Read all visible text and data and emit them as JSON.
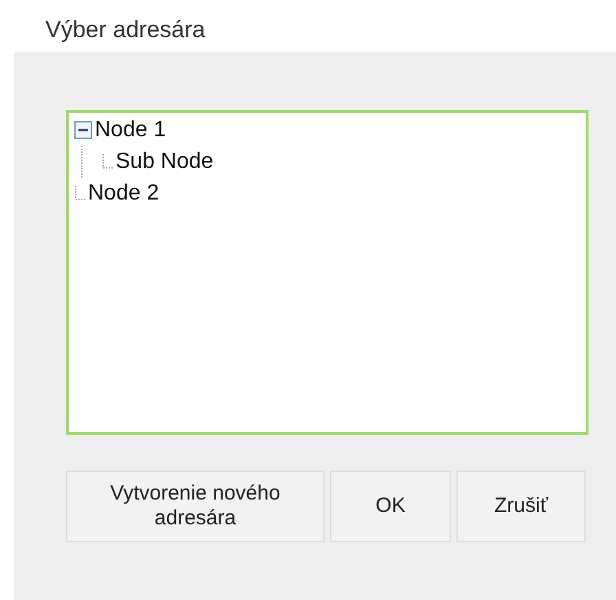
{
  "title": "Výber adresára",
  "tree": {
    "nodes": [
      {
        "label": "Node 1",
        "expanded": true,
        "children": [
          {
            "label": "Sub Node"
          }
        ]
      },
      {
        "label": "Node 2"
      }
    ]
  },
  "buttons": [
    {
      "label": "Vytvorenie nového adresára"
    },
    {
      "label": "OK"
    },
    {
      "label": "Zrušiť"
    }
  ]
}
